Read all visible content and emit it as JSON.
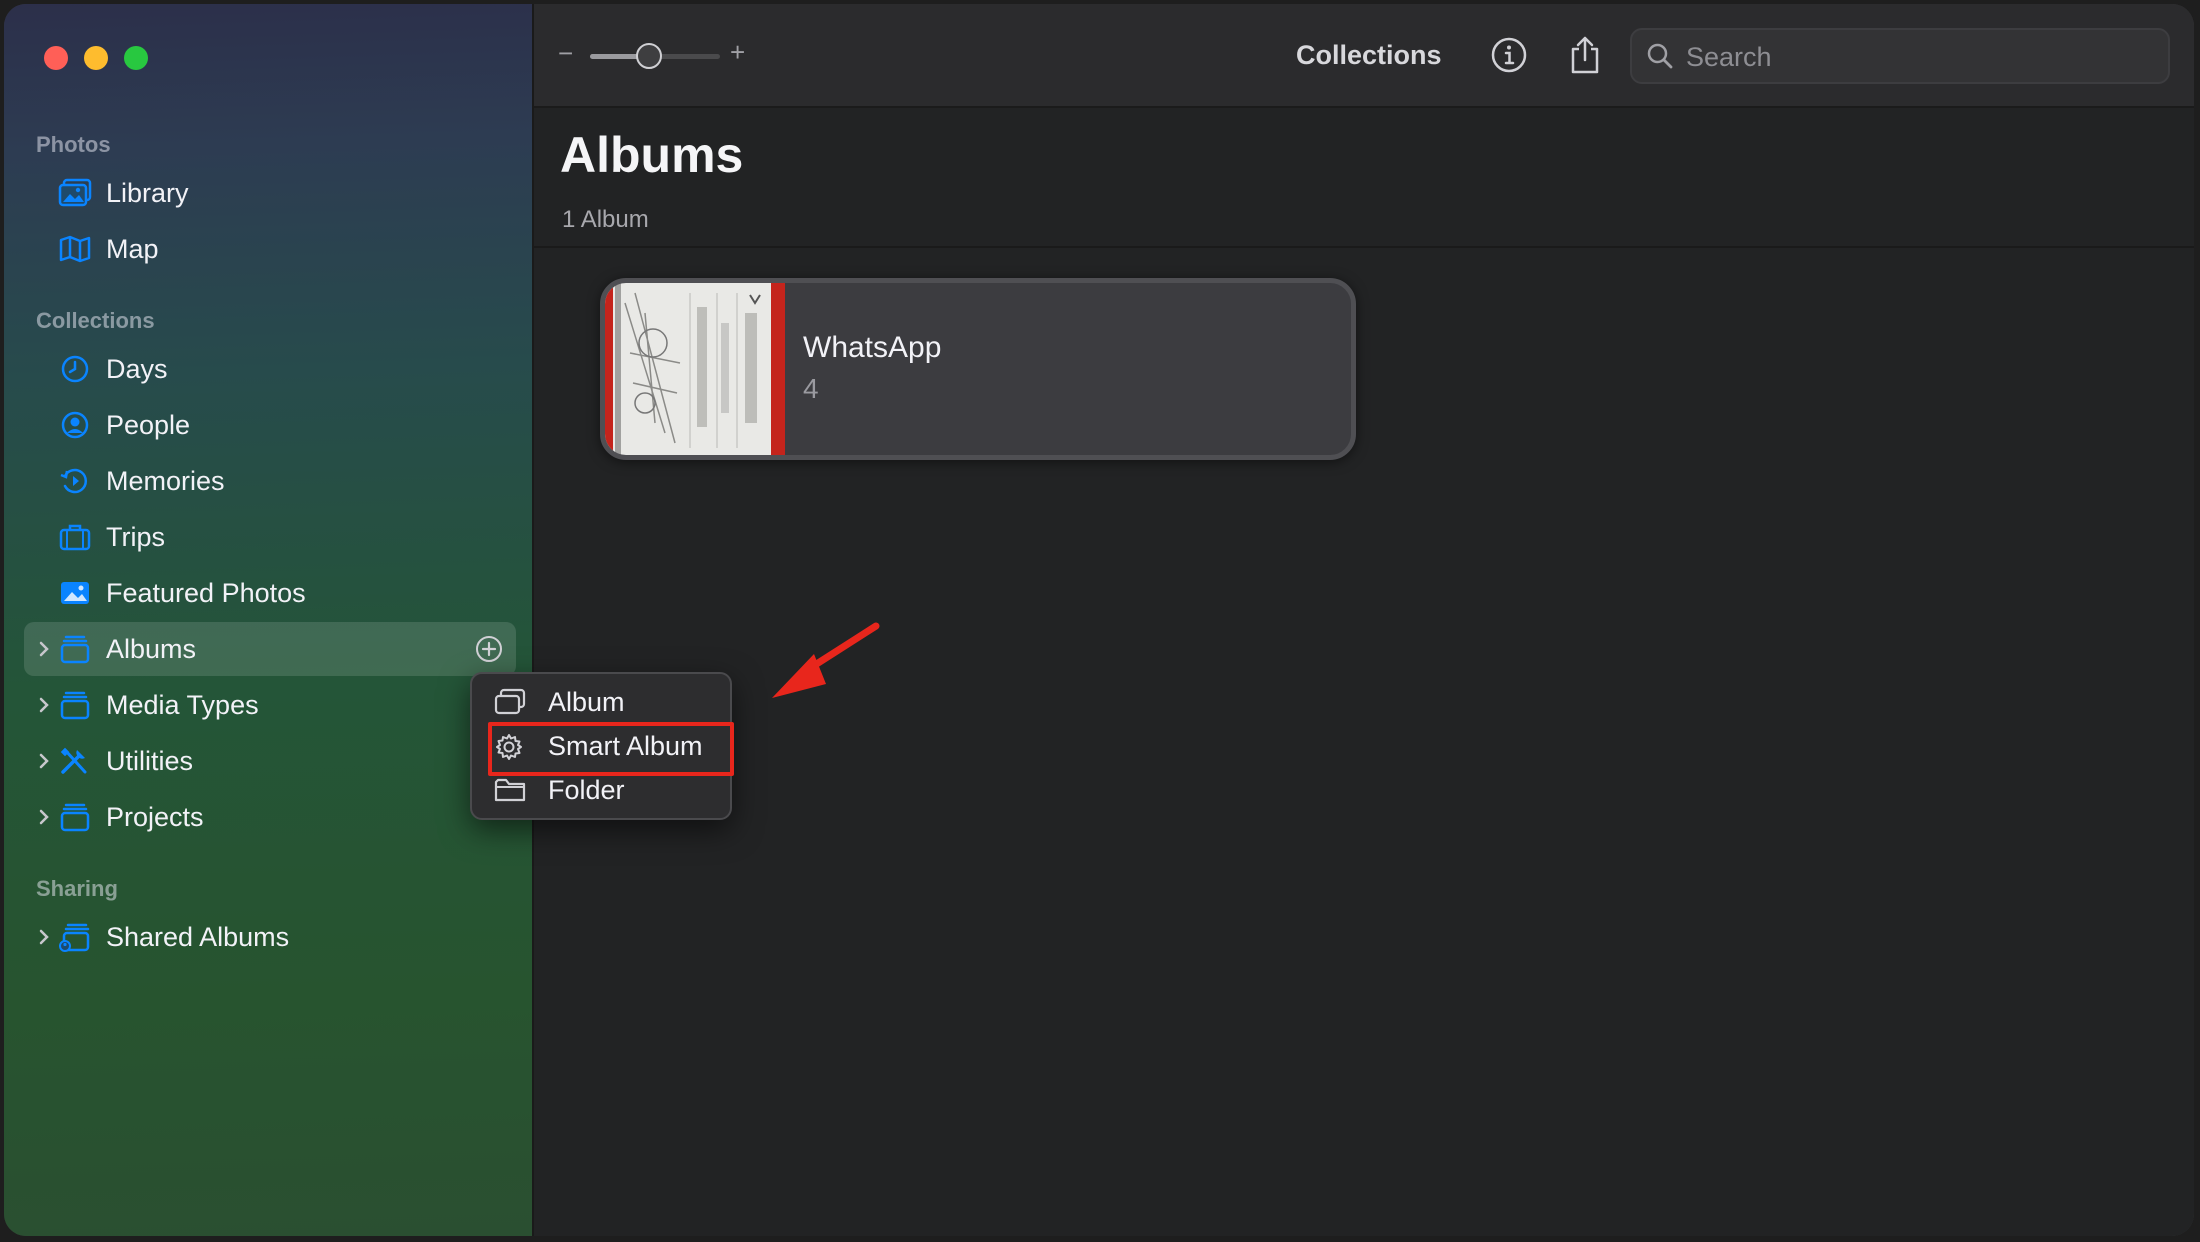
{
  "sidebar": {
    "sections": {
      "photos": "Photos",
      "collections": "Collections",
      "sharing": "Sharing"
    },
    "items": [
      {
        "label": "Library"
      },
      {
        "label": "Map"
      },
      {
        "label": "Days"
      },
      {
        "label": "People"
      },
      {
        "label": "Memories"
      },
      {
        "label": "Trips"
      },
      {
        "label": "Featured Photos"
      },
      {
        "label": "Albums"
      },
      {
        "label": "Media Types"
      },
      {
        "label": "Utilities"
      },
      {
        "label": "Projects"
      },
      {
        "label": "Shared Albums"
      }
    ],
    "selected": "Albums"
  },
  "toolbar": {
    "title": "Collections",
    "search_placeholder": "Search",
    "zoom_minus": "−",
    "zoom_plus": "+",
    "zoom_level": 0.45
  },
  "content": {
    "title": "Albums",
    "subtitle": "1 Album",
    "albums": [
      {
        "name": "WhatsApp",
        "count": "4"
      }
    ]
  },
  "context_menu": {
    "items": [
      {
        "label": "Album",
        "icon": "album-icon"
      },
      {
        "label": "Smart Album",
        "icon": "gear-icon"
      },
      {
        "label": "Folder",
        "icon": "folder-icon"
      }
    ],
    "highlighted": "Smart Album"
  },
  "colors": {
    "accent": "#0a84ff",
    "highlight": "#e8261c"
  }
}
